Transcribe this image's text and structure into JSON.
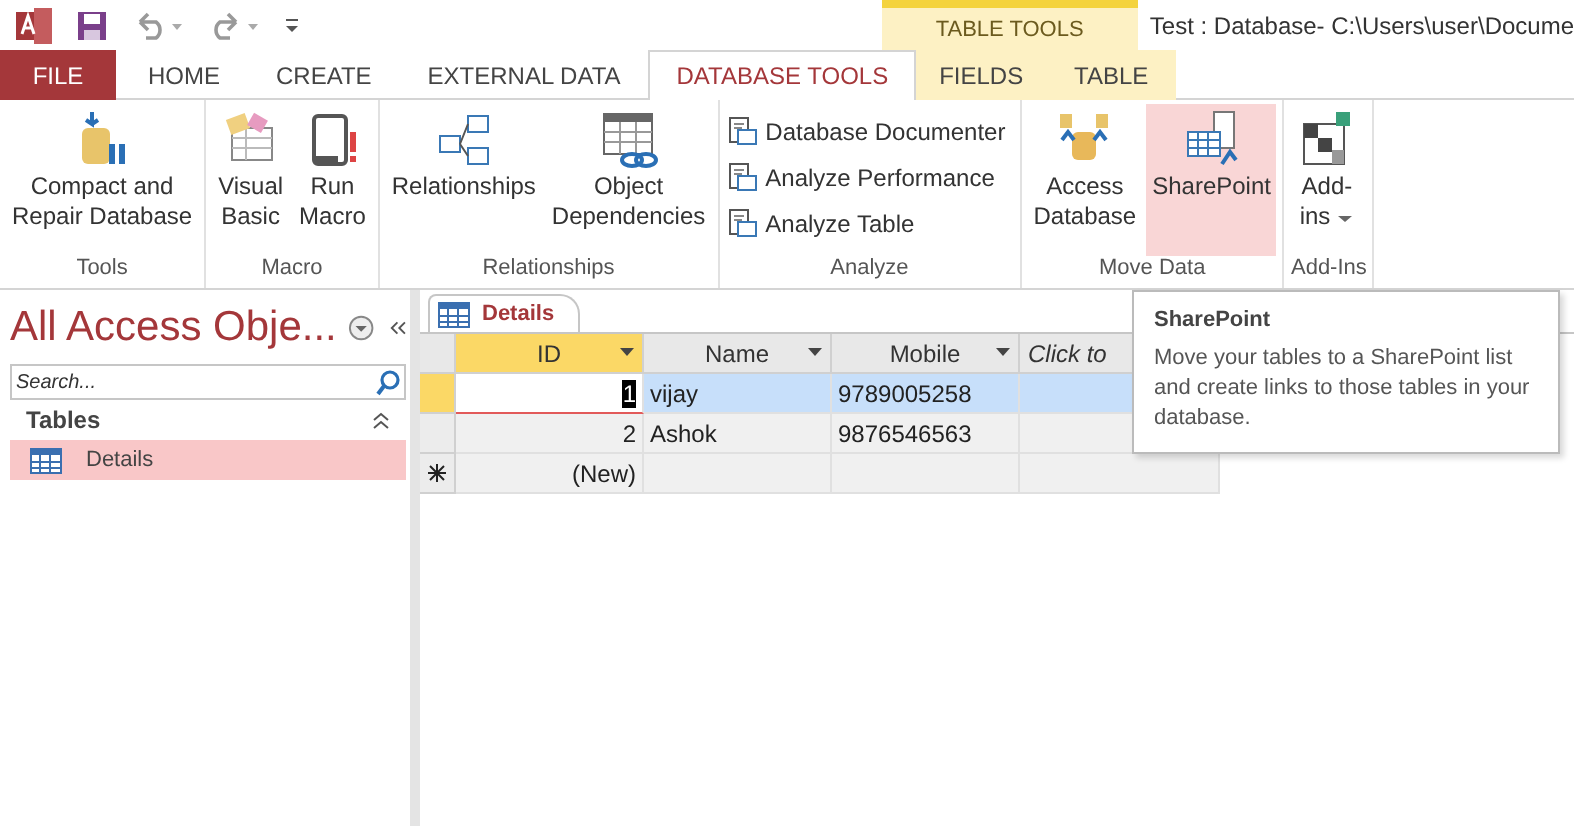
{
  "title_bar": {
    "contextual_group": "TABLE TOOLS",
    "title": "Test : Database- C:\\Users\\user\\Docume"
  },
  "tabs": [
    {
      "label": "FILE",
      "kind": "file",
      "selected": false
    },
    {
      "label": "HOME",
      "kind": "normal",
      "selected": false
    },
    {
      "label": "CREATE",
      "kind": "normal",
      "selected": false
    },
    {
      "label": "EXTERNAL DATA",
      "kind": "normal",
      "selected": false
    },
    {
      "label": "DATABASE TOOLS",
      "kind": "normal",
      "selected": true
    },
    {
      "label": "FIELDS",
      "kind": "contextual",
      "selected": false
    },
    {
      "label": "TABLE",
      "kind": "contextual",
      "selected": false
    }
  ],
  "ribbon": [
    {
      "label": "Tools",
      "items": [
        {
          "kind": "large",
          "lines": [
            "Compact and",
            "Repair Database"
          ],
          "highlighted": false
        }
      ]
    },
    {
      "label": "Macro",
      "items": [
        {
          "kind": "large",
          "lines": [
            "Visual",
            "Basic"
          ],
          "highlighted": false
        },
        {
          "kind": "large",
          "lines": [
            "Run",
            "Macro"
          ],
          "highlighted": false
        }
      ]
    },
    {
      "label": "Relationships",
      "items": [
        {
          "kind": "large",
          "lines": [
            "Relationships"
          ],
          "highlighted": false
        },
        {
          "kind": "large",
          "lines": [
            "Object",
            "Dependencies"
          ],
          "highlighted": false
        }
      ]
    },
    {
      "label": "Analyze",
      "items": [
        {
          "kind": "small",
          "lines": [
            "Database Documenter"
          ],
          "highlighted": false
        },
        {
          "kind": "small",
          "lines": [
            "Analyze Performance"
          ],
          "highlighted": false
        },
        {
          "kind": "small",
          "lines": [
            "Analyze Table"
          ],
          "highlighted": false
        }
      ]
    },
    {
      "label": "Move Data",
      "items": [
        {
          "kind": "large",
          "lines": [
            "Access",
            "Database"
          ],
          "highlighted": false
        },
        {
          "kind": "large",
          "lines": [
            "SharePoint"
          ],
          "highlighted": true
        }
      ]
    },
    {
      "label": "Add-Ins",
      "items": [
        {
          "kind": "large",
          "lines": [
            "Add-",
            "ins"
          ],
          "highlighted": false,
          "dropdown": true
        }
      ]
    }
  ],
  "nav_pane": {
    "title": "All Access Obje...",
    "search": {
      "placeholder": "Search..."
    },
    "sections": [
      {
        "label": "Tables",
        "expanded": true,
        "items": [
          {
            "label": "Details",
            "selected": true
          }
        ]
      }
    ]
  },
  "document_tab": {
    "label": "Details"
  },
  "datasheet": {
    "columns": [
      {
        "label": "ID",
        "current": true,
        "dropdown": true
      },
      {
        "label": "Name",
        "current": false,
        "dropdown": true
      },
      {
        "label": "Mobile",
        "current": false,
        "dropdown": true
      },
      {
        "label": "Click to",
        "current": false,
        "dropdown": false
      }
    ],
    "rows": [
      {
        "kind": "record",
        "selected": true,
        "cells": [
          "1",
          "vijay",
          "9789005258",
          ""
        ]
      },
      {
        "kind": "record",
        "selected": false,
        "cells": [
          "2",
          "Ashok",
          "9876546563",
          ""
        ]
      },
      {
        "kind": "new",
        "selected": false,
        "cells": [
          "(New)",
          "",
          "",
          ""
        ]
      }
    ]
  },
  "tooltip": {
    "title": "SharePoint",
    "text": "Move your tables to a SharePoint list and create links to those tables in your database."
  }
}
